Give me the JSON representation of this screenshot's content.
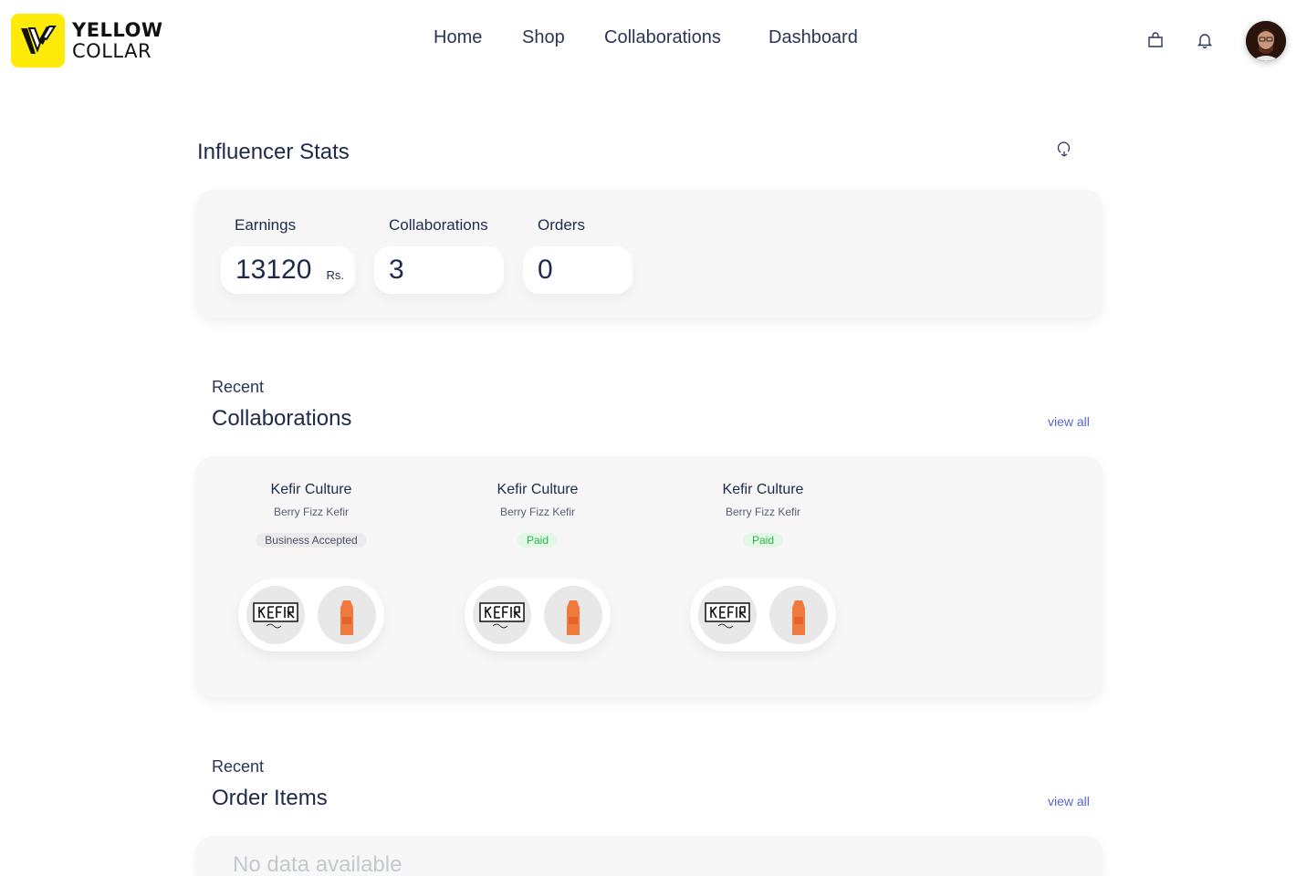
{
  "header": {
    "logo_line1": "YELLOW",
    "logo_line2": "COLLAR",
    "nav": [
      "Home",
      "Shop",
      "Collaborations",
      "Dashboard"
    ],
    "icons": [
      "shopping-bag-icon",
      "bell-icon"
    ]
  },
  "stats": {
    "title": "Influencer Stats",
    "earnings_label": "Earnings",
    "earnings_value": "13120",
    "earnings_unit": "Rs.",
    "collaborations_label": "Collaborations",
    "collaborations_value": "3",
    "orders_label": "Orders",
    "orders_value": "0"
  },
  "collaborations": {
    "sub": "Recent",
    "title": "Collaborations",
    "view_all": "view all",
    "items": [
      {
        "brand": "Kefir Culture",
        "product": "Berry Fizz Kefir",
        "status": "Business Accepted"
      },
      {
        "brand": "Kefir Culture",
        "product": "Berry Fizz Kefir",
        "status": "Paid"
      },
      {
        "brand": "Kefir Culture",
        "product": "Berry Fizz Kefir",
        "status": "Paid"
      }
    ]
  },
  "orders": {
    "sub": "Recent",
    "title": "Order Items",
    "view_all": "view all",
    "empty": "No data available"
  },
  "colors": {
    "brand_yellow": "#ffeb0a",
    "link": "#5865c8",
    "paid_green": "#29b34a",
    "text_dark": "#1e2a4a"
  }
}
